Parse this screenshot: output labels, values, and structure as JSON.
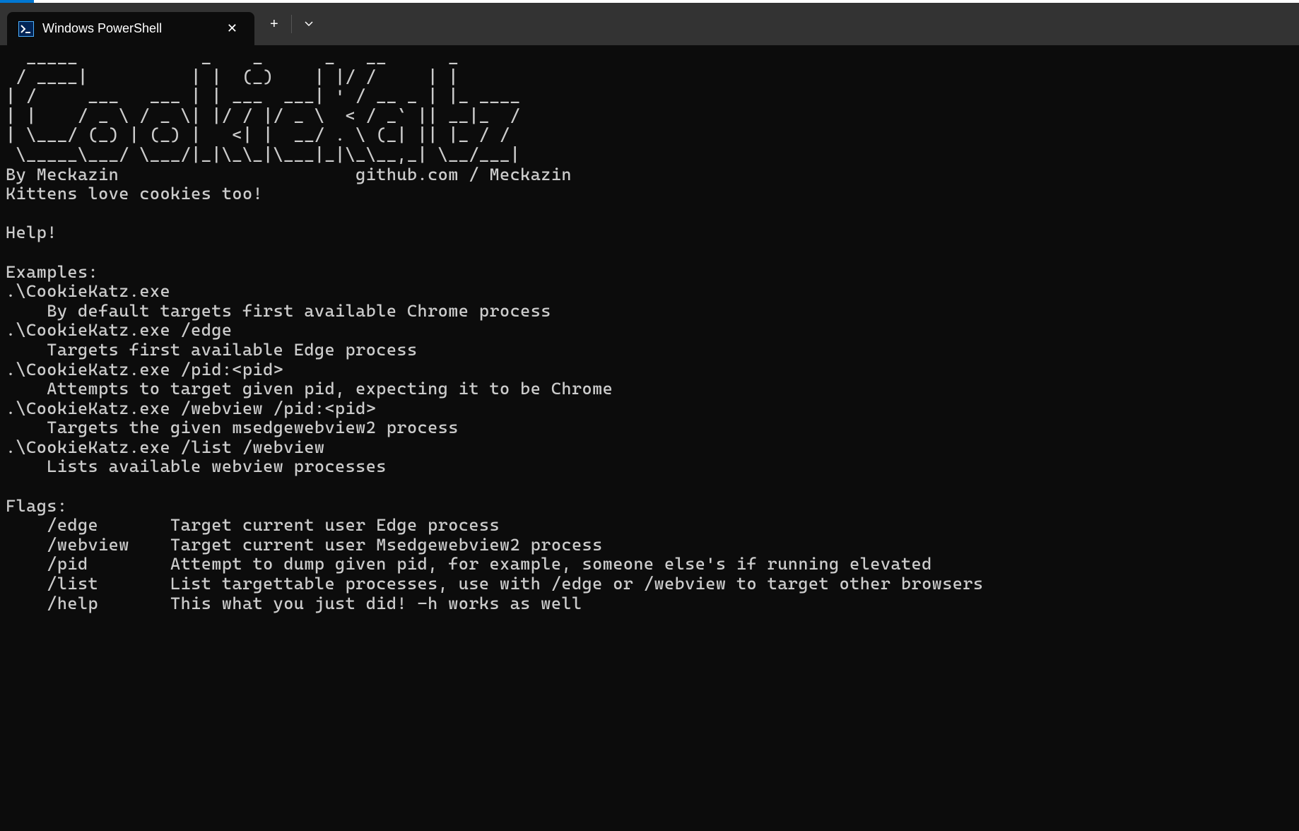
{
  "titlebar": {
    "tab_title": "Windows PowerShell",
    "tab_icon_glyph": ">_"
  },
  "terminal": {
    "ascii_art": "  _____            _    _      _   __      _       \n / ____|          | |  (_)    | |/ /     | |      \n| /     ___   ___ | | ___  ___| ' / __ _ | |_ ____\n| |    / _ \\ / _ \\| |/ / |/ _ \\  < / _` || __|_  /\n| \\___/ (_) | (_) |   <| |  __/ . \\ (_| || |_ / / \n \\_____\\___/ \\___/|_|\\_\\_|\\___|_|\\_\\__,_| \\__/___|",
    "byline": "By Meckazin                       github.com / Meckazin",
    "tagline": "Kittens love cookies too!",
    "help_heading": "Help!",
    "examples_heading": "Examples:",
    "examples": [
      {
        "cmd": ".\\CookieKatz.exe",
        "desc": "    By default targets first available Chrome process"
      },
      {
        "cmd": ".\\CookieKatz.exe /edge",
        "desc": "    Targets first available Edge process"
      },
      {
        "cmd": ".\\CookieKatz.exe /pid:<pid>",
        "desc": "    Attempts to target given pid, expecting it to be Chrome"
      },
      {
        "cmd": ".\\CookieKatz.exe /webview /pid:<pid>",
        "desc": "    Targets the given msedgewebview2 process"
      },
      {
        "cmd": ".\\CookieKatz.exe /list /webview",
        "desc": "    Lists available webview processes"
      }
    ],
    "flags_heading": "Flags:",
    "flags": [
      {
        "flag": "    /edge       ",
        "desc": "Target current user Edge process"
      },
      {
        "flag": "    /webview    ",
        "desc": "Target current user Msedgewebview2 process"
      },
      {
        "flag": "    /pid        ",
        "desc": "Attempt to dump given pid, for example, someone else's if running elevated"
      },
      {
        "flag": "    /list       ",
        "desc": "List targettable processes, use with /edge or /webview to target other browsers"
      },
      {
        "flag": "    /help       ",
        "desc": "This what you just did! -h works as well"
      }
    ]
  }
}
